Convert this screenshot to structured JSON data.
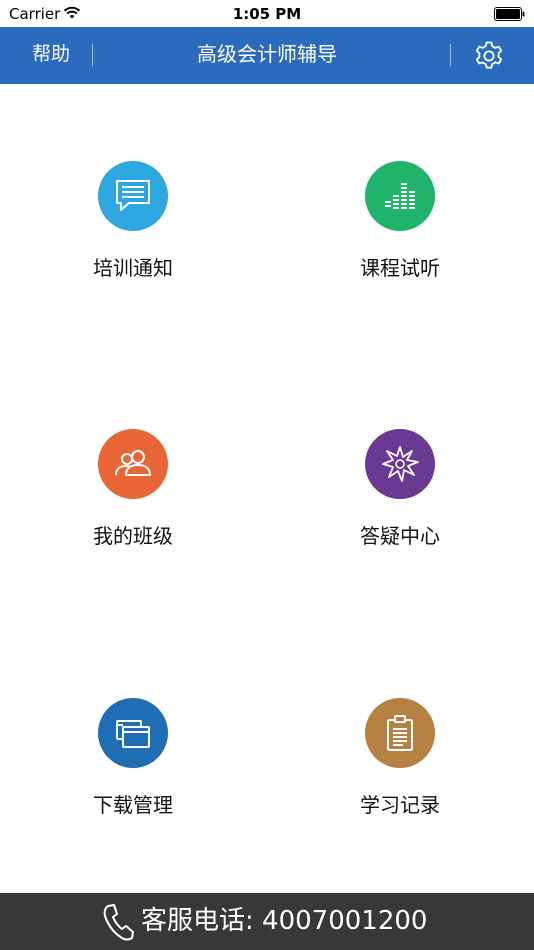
{
  "status_bar": {
    "carrier": "Carrier",
    "time": "1:05 PM"
  },
  "nav": {
    "help_label": "帮助",
    "title": "高级会计师辅导"
  },
  "tiles": [
    {
      "label": "培训通知",
      "icon": "chat-message-icon",
      "color": "#2ea7e0"
    },
    {
      "label": "课程试听",
      "icon": "audio-levels-icon",
      "color": "#1fb46a"
    },
    {
      "label": "我的班级",
      "icon": "group-users-icon",
      "color": "#ea6535"
    },
    {
      "label": "答疑中心",
      "icon": "star-burst-icon",
      "color": "#6a3a93"
    },
    {
      "label": "下载管理",
      "icon": "windows-stack-icon",
      "color": "#1f6db5"
    },
    {
      "label": "学习记录",
      "icon": "clipboard-icon",
      "color": "#b58140"
    }
  ],
  "hotline": {
    "text": "客服电话: 4007001200"
  },
  "colors": {
    "nav_bar": "#2a6bbd",
    "hotline_bar": "#383838"
  }
}
